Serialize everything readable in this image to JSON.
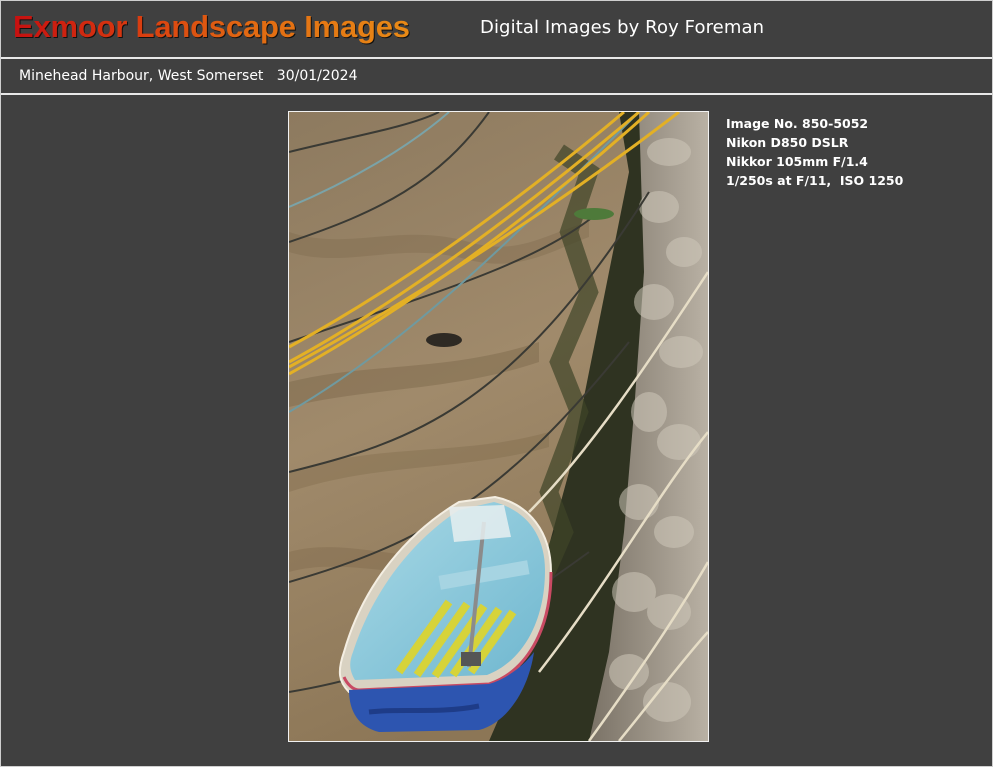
{
  "header": {
    "site_title": "Exmoor Landscape Images",
    "byline": "Digital Images by Roy Foreman"
  },
  "subbar": {
    "location": "Minehead Harbour, West Somerset",
    "date": "30/01/2024"
  },
  "photo": {
    "alt": "Minehead Harbour, West Somerset"
  },
  "exif": {
    "image_no": "Image No. 850-5052",
    "camera": "Nikon D850 DSLR",
    "lens": "Nikkor 105mm F/1.4",
    "exposure": "1/250s at F/11,  ISO 1250"
  },
  "colors": {
    "background": "#404040",
    "title_start": "#c61010",
    "title_end": "#e88a16",
    "rule": "#e8e8e8"
  }
}
